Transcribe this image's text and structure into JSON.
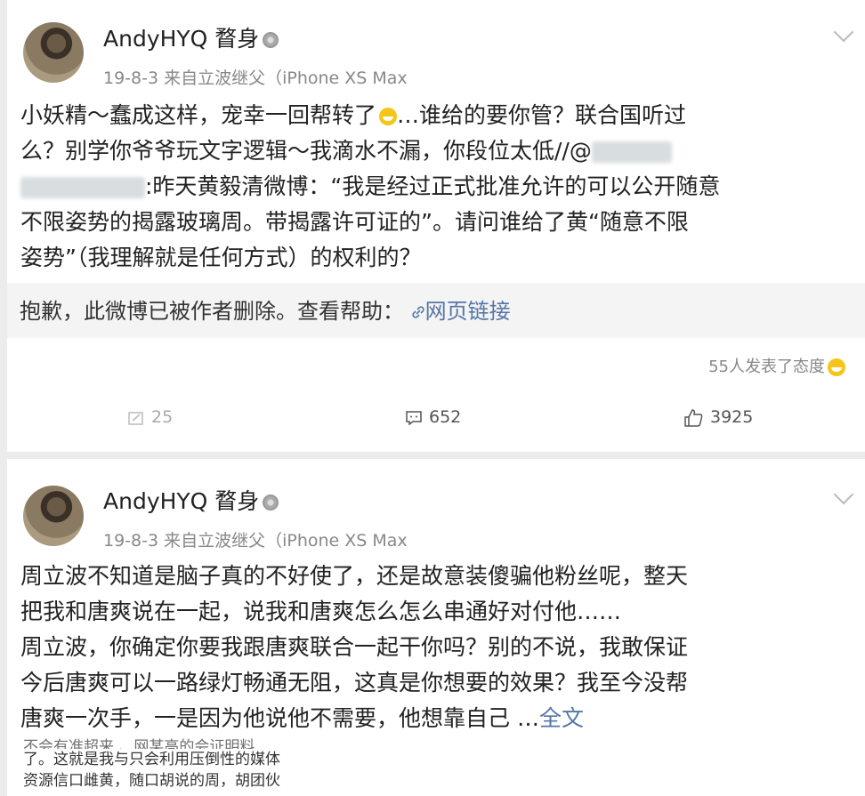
{
  "posts": [
    {
      "username": "AndyHYQ 瞀身",
      "meta": "19-8-3  来自立波继父（iPhone XS Max",
      "line1": "小妖精～蠢成这样，宠幸一回帮转了",
      "line1b": "…谁给的要你管？联合国听过",
      "line2": "么？别学你爷爷玩文字逻辑～我滴水不漏，你段位太低//@",
      "line3": ":昨天黄毅清微博：“我是经过正式批准允许的可以公开随意",
      "line4": "不限姿势的揭露玻璃周。带揭露许可证的”。请问谁给了黄“随意不限",
      "line5": "姿势”（我理解就是任何方式）的权利的？",
      "deleted_text": "抱歉，此微博已被作者删除。查看帮助：",
      "deleted_link": "网页链接",
      "reaction_text": "55人发表了态度",
      "repost_count": "25",
      "comment_count": "652",
      "like_count": "3925"
    },
    {
      "username": "AndyHYQ 瞀身",
      "meta": "19-8-3  来自立波继父（iPhone XS Max",
      "lines": [
        "周立波不知道是脑子真的不好使了，还是故意装傻骗他粉丝呢，整天",
        "把我和唐爽说在一起，说我和唐爽怎么怎么串通好对付他……",
        "周立波，你确定你要我跟唐爽联合一起干你吗？别的不说，我敢保证",
        "今后唐爽可以一路绿灯畅通无阻，这真是你想要的效果？我至今没帮",
        "唐爽一次手，一是因为他说他不需要，他想靠自己 …"
      ],
      "more_label": "全文",
      "snippet_lines": [
        "不会有准超来 、网某高的会证明料",
        "了。这就是我与只会利用压倒性的媒体",
        "资源信口雌黄，随口胡说的周，胡团伙"
      ]
    }
  ],
  "colors": {
    "link": "#5576a6",
    "background": "#ececec"
  }
}
